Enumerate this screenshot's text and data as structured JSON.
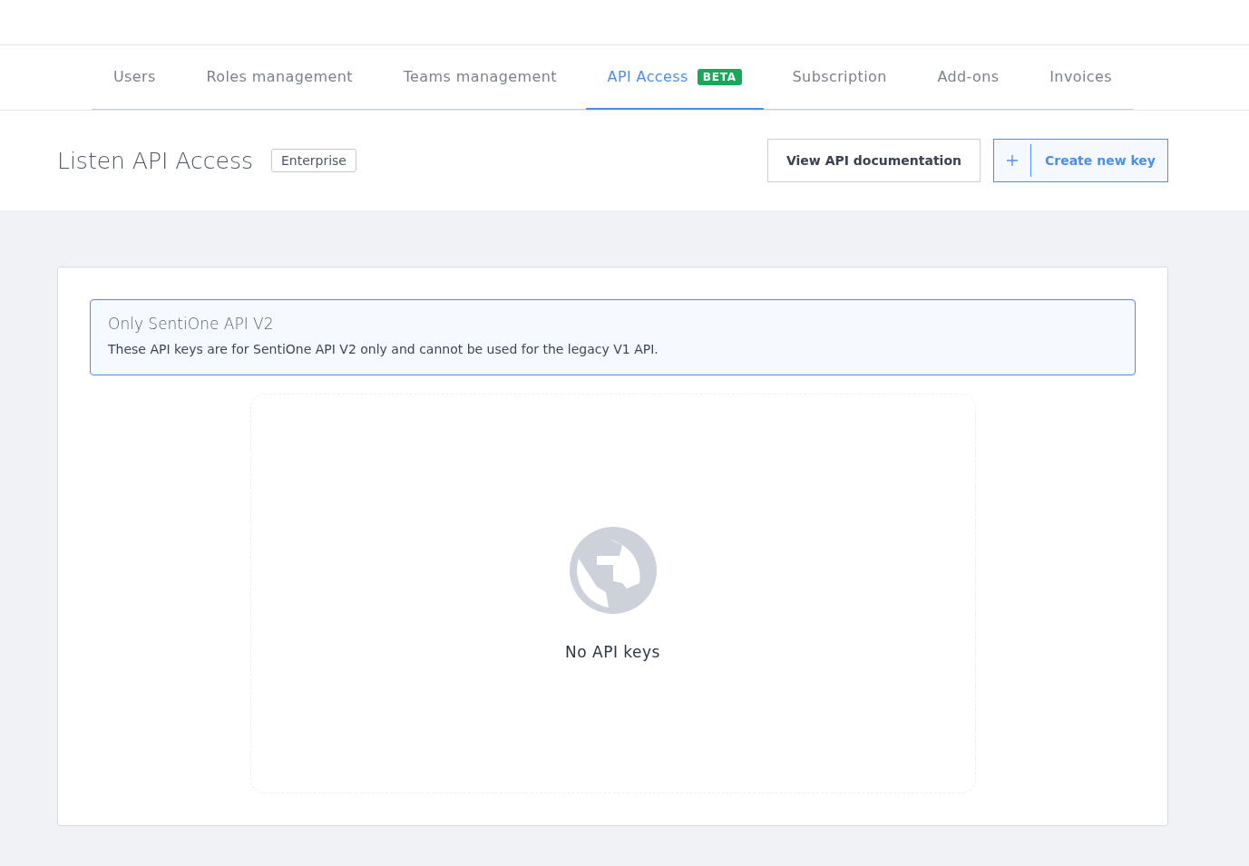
{
  "tabs": [
    {
      "label": "Users",
      "selected": false
    },
    {
      "label": "Roles management",
      "selected": false
    },
    {
      "label": "Teams management",
      "selected": false
    },
    {
      "label": "API Access",
      "selected": true,
      "badge": "BETA"
    },
    {
      "label": "Subscription",
      "selected": false
    },
    {
      "label": "Add-ons",
      "selected": false
    },
    {
      "label": "Invoices",
      "selected": false
    }
  ],
  "header": {
    "title": "Listen API Access",
    "plan_badge": "Enterprise",
    "buttons": [
      {
        "kind": "secondary",
        "label": "View API documentation"
      },
      {
        "kind": "primary",
        "label": "Create new key"
      }
    ]
  },
  "notice": {
    "title": "Only SentiOne API V2",
    "text": "These API keys are for SentiOne API V2 only and cannot be used for the legacy V1 API."
  },
  "empty_state": {
    "message": "No API keys"
  }
}
